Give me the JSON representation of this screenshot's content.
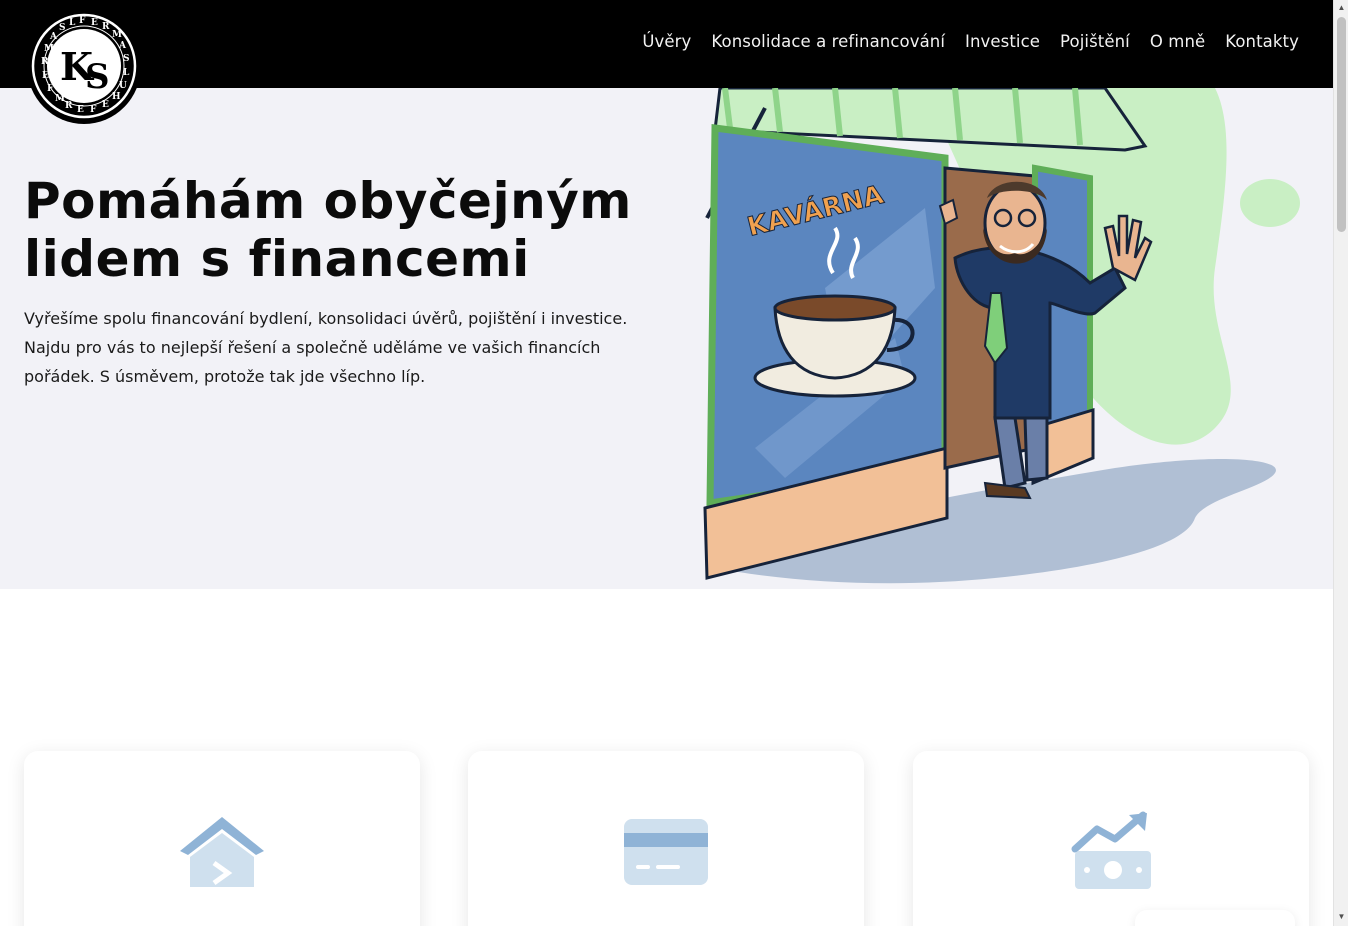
{
  "brand": {
    "logo_letters": "KS",
    "logo_ring_text": "FERMAS LUHE FERM"
  },
  "nav": {
    "items": [
      {
        "label": "Úvěry"
      },
      {
        "label": "Konsolidace a refinancování"
      },
      {
        "label": "Investice"
      },
      {
        "label": "Pojištění"
      },
      {
        "label": "O mně"
      },
      {
        "label": "Kontakty"
      }
    ]
  },
  "hero": {
    "title": "Pomáhám obyčejným lidem s financemi",
    "text": "Vyřešíme spolu financování bydlení, konsolidaci úvěrů, pojištění i investice. Najdu pro vás to nejlepší řešení a společně uděláme ve vašich financích pořádek. S úsměvem, protože tak jde všechno líp.",
    "sign_text": "KAVÁRNA"
  },
  "cards": [
    {
      "icon": "house-icon"
    },
    {
      "icon": "credit-card-icon"
    },
    {
      "icon": "money-growth-icon"
    }
  ],
  "colors": {
    "header_bg": "#000000",
    "hero_bg": "#f2f2f7",
    "icon_blue": "#8fb3d6",
    "icon_light": "#cfe0ee"
  }
}
